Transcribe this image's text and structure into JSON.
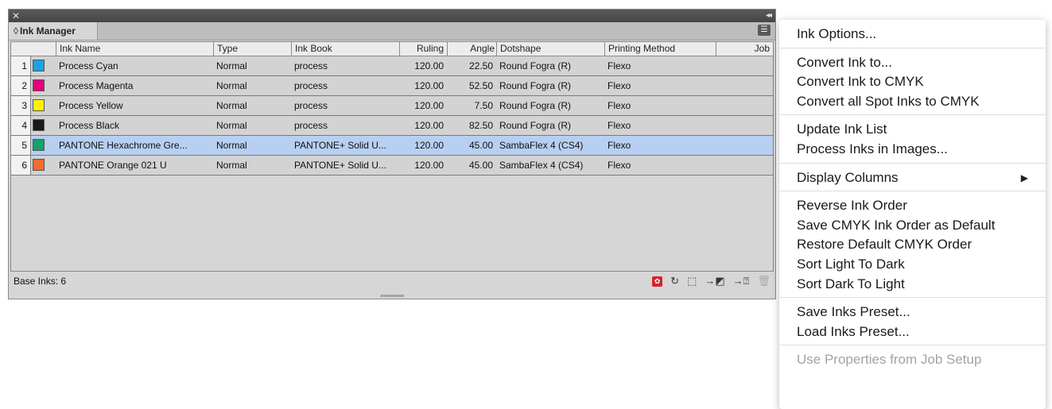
{
  "panel": {
    "title": "Ink Manager",
    "tab_arrows": "◊",
    "columns": [
      "Ink Name",
      "Type",
      "Ink Book",
      "Ruling",
      "Angle",
      "Dotshape",
      "Printing Method",
      "Job"
    ],
    "rows": [
      {
        "num": "1",
        "color": "#1ba3e0",
        "name": "Process Cyan",
        "type": "Normal",
        "book": "process",
        "ruling": "120.00",
        "angle": "22.50",
        "dotshape": "Round Fogra (R)",
        "method": "Flexo"
      },
      {
        "num": "2",
        "color": "#e6007e",
        "name": "Process Magenta",
        "type": "Normal",
        "book": "process",
        "ruling": "120.00",
        "angle": "52.50",
        "dotshape": "Round Fogra (R)",
        "method": "Flexo"
      },
      {
        "num": "3",
        "color": "#fff200",
        "name": "Process Yellow",
        "type": "Normal",
        "book": "process",
        "ruling": "120.00",
        "angle": "7.50",
        "dotshape": "Round Fogra (R)",
        "method": "Flexo"
      },
      {
        "num": "4",
        "color": "#1a1a1a",
        "name": "Process Black",
        "type": "Normal",
        "book": "process",
        "ruling": "120.00",
        "angle": "82.50",
        "dotshape": "Round Fogra (R)",
        "method": "Flexo"
      },
      {
        "num": "5",
        "color": "#12a36a",
        "name": "PANTONE Hexachrome Gre...",
        "type": "Normal",
        "book": "PANTONE+ Solid U...",
        "ruling": "120.00",
        "angle": "45.00",
        "dotshape": "SambaFlex 4 (CS4)",
        "method": "Flexo",
        "selected": true
      },
      {
        "num": "6",
        "color": "#f26b2e",
        "name": "PANTONE Orange 021 U",
        "type": "Normal",
        "book": "PANTONE+ Solid U...",
        "ruling": "120.00",
        "angle": "45.00",
        "dotshape": "SambaFlex 4 (CS4)",
        "method": "Flexo"
      }
    ],
    "footer_label": "Base Inks: 6",
    "footer_icons": [
      "ink-settings-icon",
      "refresh-icon",
      "frame-icon",
      "convert-to-cmyk-icon",
      "convert-unknown-icon",
      "trash-icon"
    ]
  },
  "menu": {
    "items": [
      {
        "label": "Ink Options...",
        "group": 0
      },
      {
        "label": "Convert Ink to...",
        "group": 1
      },
      {
        "label": "Convert Ink to CMYK",
        "group": 1
      },
      {
        "label": "Convert all Spot Inks to CMYK",
        "group": 1
      },
      {
        "label": "Update Ink List",
        "group": 2
      },
      {
        "label": "Process Inks in Images...",
        "group": 2
      },
      {
        "label": "Display Columns",
        "group": 3,
        "submenu": true
      },
      {
        "label": "Reverse Ink Order",
        "group": 4
      },
      {
        "label": "Save CMYK Ink Order as Default",
        "group": 4
      },
      {
        "label": "Restore Default CMYK Order",
        "group": 4
      },
      {
        "label": "Sort Light To Dark",
        "group": 4
      },
      {
        "label": "Sort Dark To Light",
        "group": 4
      },
      {
        "label": "Save Inks Preset...",
        "group": 5
      },
      {
        "label": "Load Inks Preset...",
        "group": 5
      },
      {
        "label": "Use Properties from Job Setup",
        "group": 6,
        "disabled": true
      }
    ],
    "submenu_arrow": "▶"
  }
}
